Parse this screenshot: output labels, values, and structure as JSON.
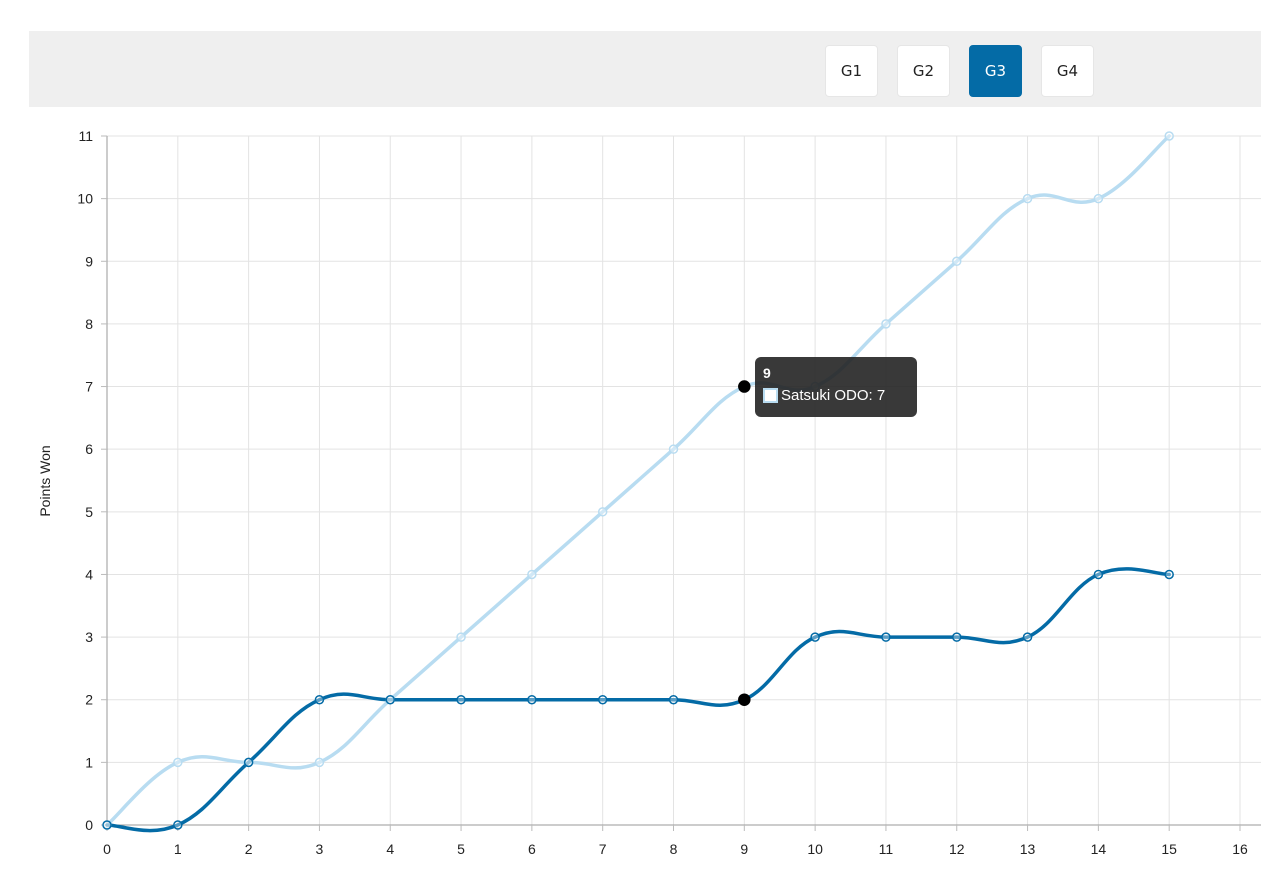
{
  "header": {
    "tabs": [
      {
        "label": "G1",
        "active": false
      },
      {
        "label": "G2",
        "active": false
      },
      {
        "label": "G3",
        "active": true
      },
      {
        "label": "G4",
        "active": false
      }
    ],
    "active_color": "#046ba6"
  },
  "tooltip": {
    "title": "9",
    "series_label": "Satsuki ODO: 7"
  },
  "chart_data": {
    "type": "line",
    "title": "",
    "xlabel": "",
    "ylabel": "Points Won",
    "xlim": [
      0,
      16
    ],
    "ylim": [
      0,
      11
    ],
    "x_ticks": [
      0,
      1,
      2,
      3,
      4,
      5,
      6,
      7,
      8,
      9,
      10,
      11,
      12,
      13,
      14,
      15,
      16
    ],
    "y_ticks": [
      0,
      1,
      2,
      3,
      4,
      5,
      6,
      7,
      8,
      9,
      10,
      11
    ],
    "grid": true,
    "x": [
      0,
      1,
      2,
      3,
      4,
      5,
      6,
      7,
      8,
      9,
      10,
      11,
      12,
      13,
      14,
      15
    ],
    "series": [
      {
        "name": "Satsuki ODO",
        "color": "#b8dcf1",
        "values": [
          0,
          1,
          1,
          1,
          2,
          3,
          4,
          5,
          6,
          7,
          7,
          8,
          9,
          10,
          10,
          11
        ]
      },
      {
        "color": "#046ba6",
        "values": [
          0,
          0,
          1,
          2,
          2,
          2,
          2,
          2,
          2,
          2,
          3,
          3,
          3,
          3,
          4,
          4
        ]
      }
    ],
    "highlight_x": 9
  }
}
